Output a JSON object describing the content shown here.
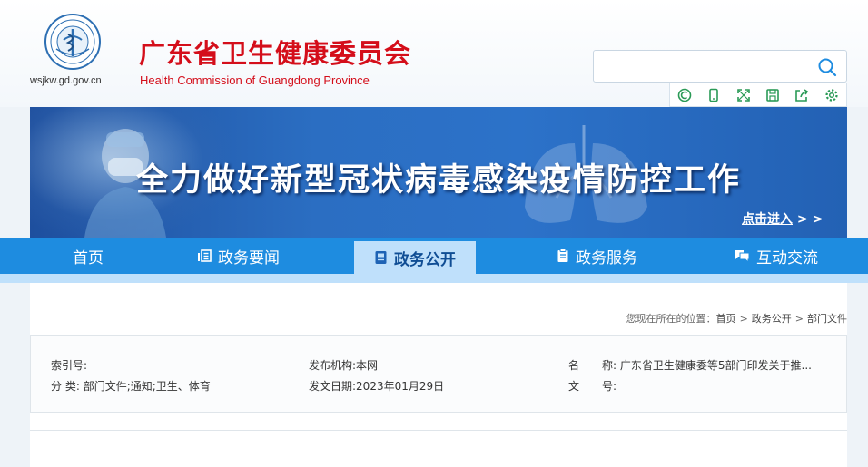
{
  "header": {
    "org_name_cn": "广东省卫生健康委员会",
    "org_name_en": "Health Commission of Guangdong Province",
    "domain": "wsjkw.gd.gov.cn",
    "logo_icon": "health-commission-emblem-icon"
  },
  "search": {
    "value": "",
    "placeholder": "",
    "icon": "search-icon"
  },
  "tools": [
    {
      "name": "accessibility-icon"
    },
    {
      "name": "mobile-icon"
    },
    {
      "name": "fullscreen-icon"
    },
    {
      "name": "save-icon"
    },
    {
      "name": "share-icon"
    },
    {
      "name": "settings-icon"
    }
  ],
  "banner": {
    "title": "全力做好新型冠状病毒感染疫情防控工作",
    "link_text": "点击进入",
    "link_arrows": "> >"
  },
  "nav": {
    "items": [
      {
        "label": "首页",
        "icon": ""
      },
      {
        "label": "政务要闻",
        "icon": "news-icon"
      },
      {
        "label": "政务公开",
        "icon": "disclosure-icon",
        "active": true
      },
      {
        "label": "政务服务",
        "icon": "service-icon"
      },
      {
        "label": "互动交流",
        "icon": "interaction-icon"
      }
    ]
  },
  "breadcrumb": {
    "prefix": "您现在所在的位置：",
    "items": [
      "首页",
      "政务公开",
      "部门文件"
    ],
    "separator": ">"
  },
  "meta": {
    "index_label": "索引号:",
    "index_value": "",
    "category_label": "分 类:",
    "category_value": "部门文件;通知;卫生、体育",
    "publisher_label": "发布机构:",
    "publisher_value": "本网",
    "date_label": "发文日期:",
    "date_value": "2023年01月29日",
    "name_label_a": "名",
    "name_label_b": "称:",
    "name_value": "广东省卫生健康委等5部门印发关于推...",
    "docno_label_a": "文",
    "docno_label_b": "号:",
    "docno_value": ""
  },
  "colors": {
    "brand_red": "#d40e1a",
    "nav_blue": "#1e8ce0",
    "nav_active_bg": "#bfe0fb",
    "nav_active_text": "#0f4d94",
    "banner_blue": "#2b6ec2",
    "tool_green": "#2a9a56"
  }
}
